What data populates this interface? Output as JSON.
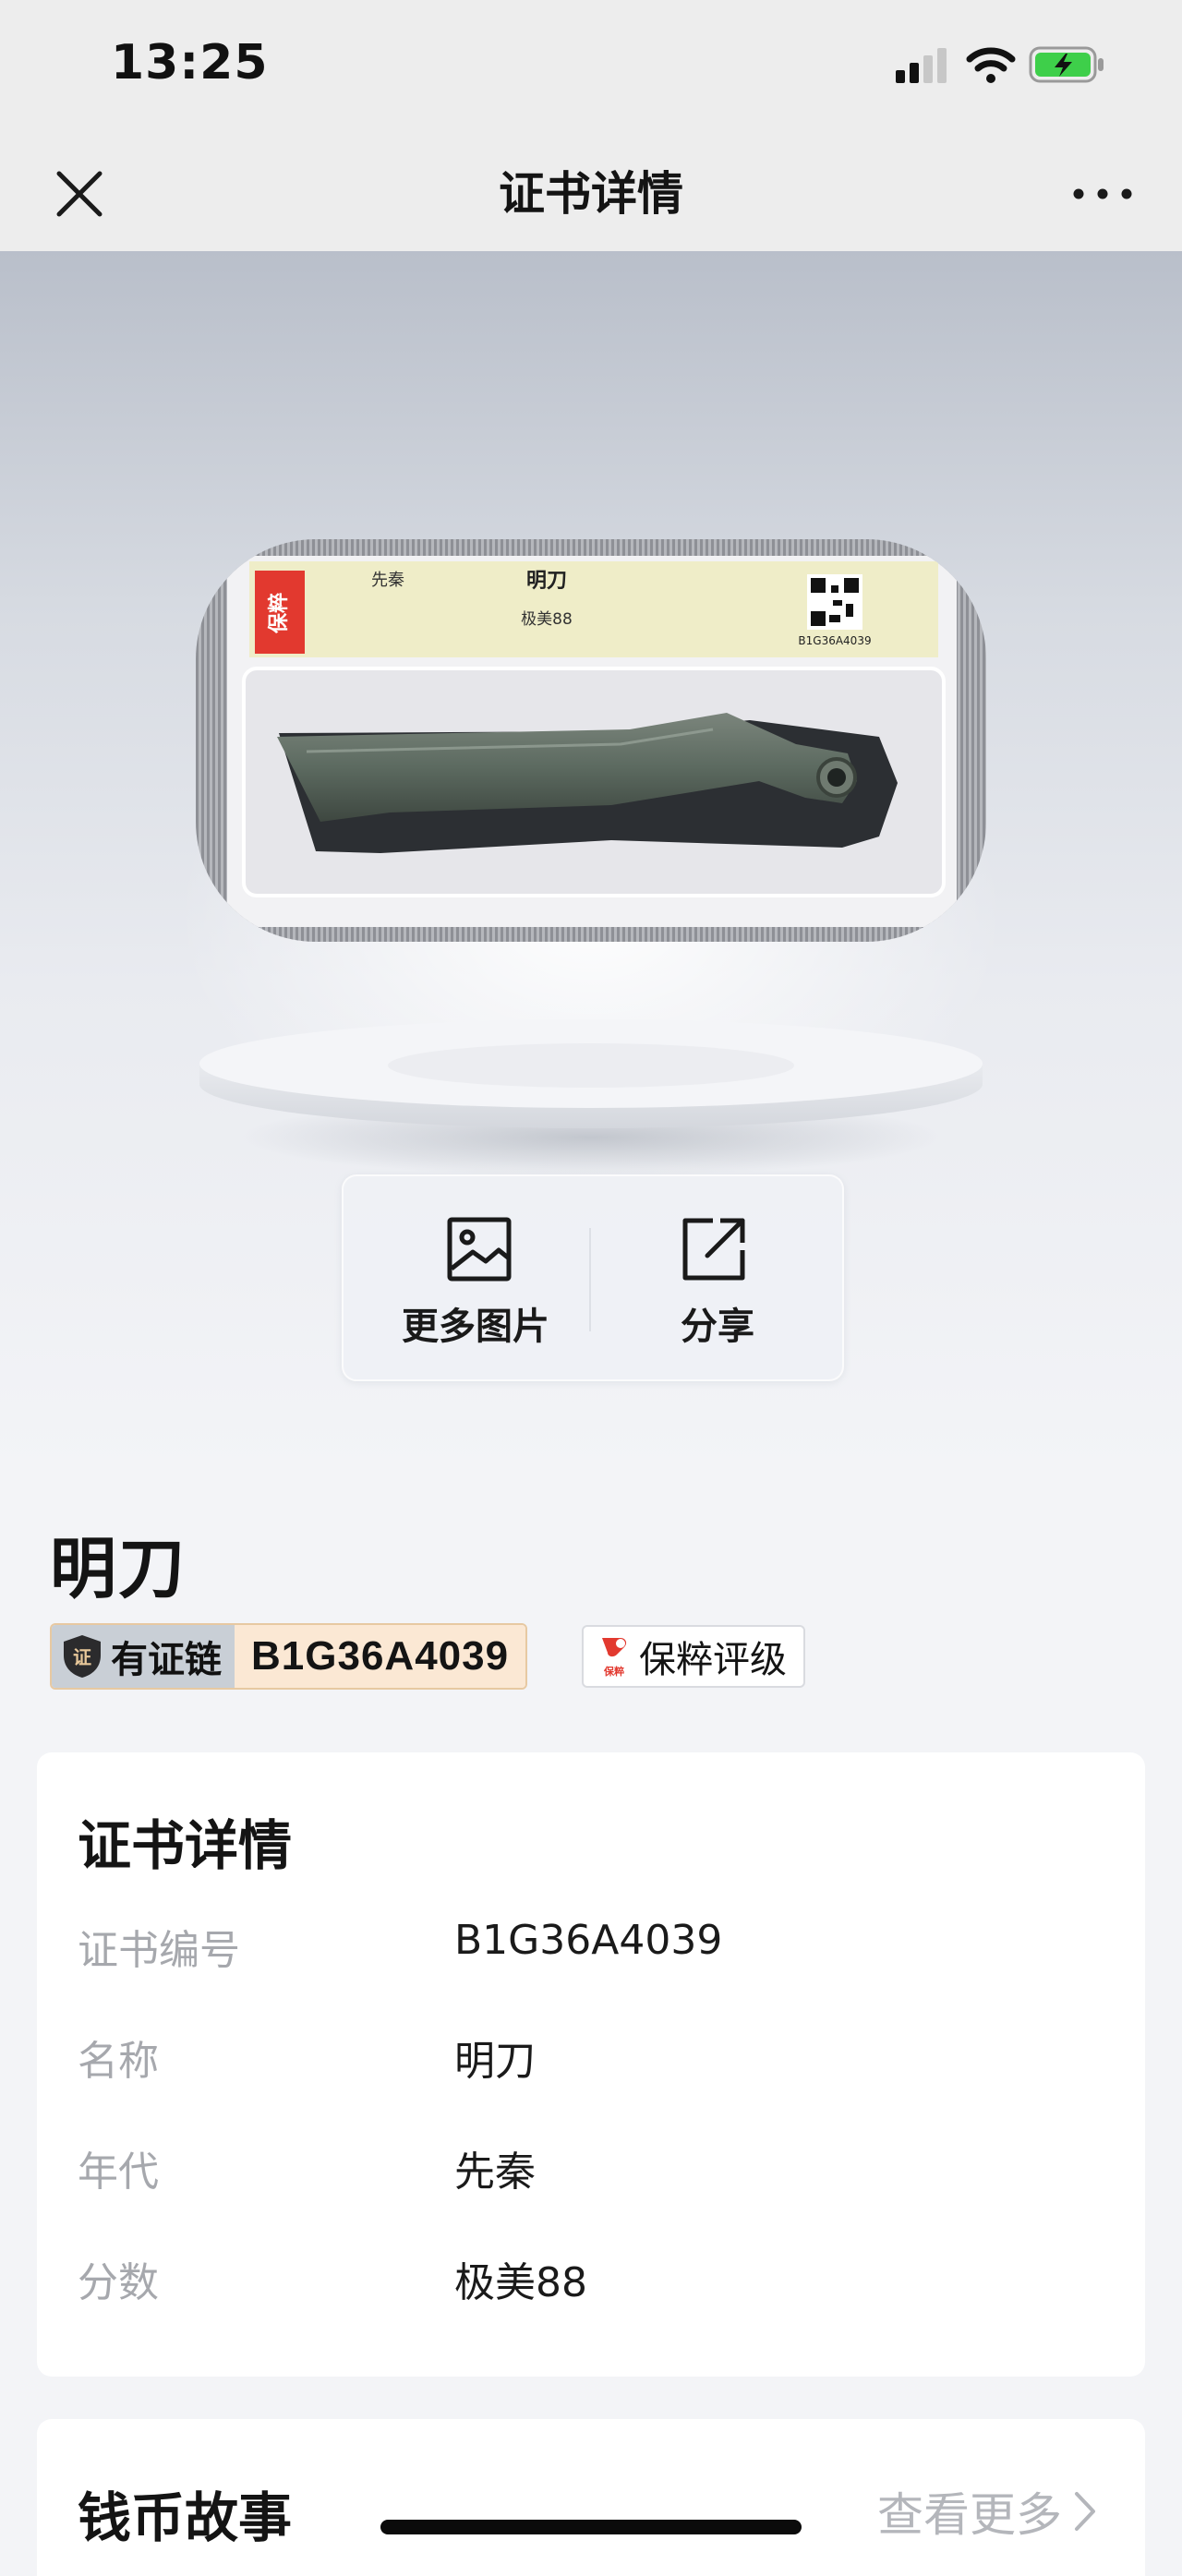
{
  "status_bar": {
    "time": "13:25",
    "icons": [
      "cellular-signal-icon",
      "wifi-icon",
      "battery-charging-icon"
    ],
    "battery_color": "#3ecf4a"
  },
  "nav": {
    "title": "证书详情",
    "close_icon": "close-icon",
    "more_icon": "more-dots-icon"
  },
  "hero": {
    "slab": {
      "label_era": "先秦",
      "label_name": "明刀",
      "label_grade": "极美88",
      "label_code": "B1G36A4039"
    },
    "actions": [
      {
        "label": "更多图片",
        "icon": "image-icon"
      },
      {
        "label": "分享",
        "icon": "share-icon"
      }
    ]
  },
  "item": {
    "title": "明刀",
    "chain_badge_label": "有证链",
    "chain_code": "B1G36A4039",
    "grader_label": "保粹评级",
    "badge_border_color": "#e7c9a2"
  },
  "cert": {
    "heading": "证书详情",
    "rows": [
      {
        "label": "证书编号",
        "value": "B1G36A4039"
      },
      {
        "label": "名称",
        "value": "明刀"
      },
      {
        "label": "年代",
        "value": "先秦"
      },
      {
        "label": "分数",
        "value": "极美88"
      }
    ]
  },
  "story": {
    "heading": "钱币故事",
    "more_label": "查看更多"
  }
}
